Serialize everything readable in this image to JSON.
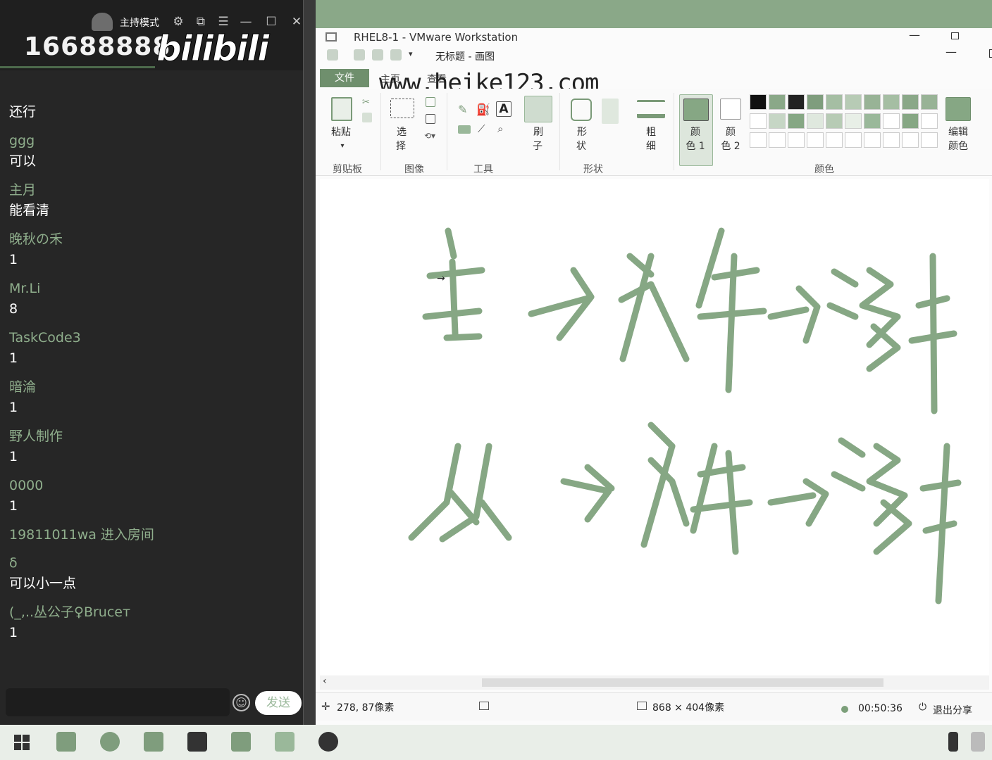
{
  "chat": {
    "host_mode": "主持模式",
    "room_id": "16688888",
    "logo": "bilibili",
    "messages": [
      {
        "name": "",
        "text": "还行"
      },
      {
        "name": "ggg",
        "text": "可以"
      },
      {
        "name": "主月",
        "text": "能看清"
      },
      {
        "name": "晚秋の禾",
        "text": "1"
      },
      {
        "name": "Mr.Li",
        "text": "8"
      },
      {
        "name": "TaskCode3",
        "text": "1"
      },
      {
        "name": "暗淪",
        "text": "1"
      },
      {
        "name": "野人制作",
        "text": "1"
      },
      {
        "name": "0000",
        "text": "1"
      },
      {
        "name": "19811011wa 进入房间",
        "text": ""
      },
      {
        "name": "δ",
        "text": "可以小一点"
      },
      {
        "name": "(_,..丛公子♀Bruceт",
        "text": "1"
      }
    ],
    "send_label": "发送"
  },
  "vmware": {
    "title": "RHEL8-1 - VMware Workstation"
  },
  "paint": {
    "title": "无标题 - 画图",
    "tabs": {
      "file": "文件",
      "home": "主页",
      "view": "查看"
    },
    "watermark": "www.heike123.com",
    "tools": {
      "paste": "粘贴",
      "select_a": "选",
      "select_b": "择",
      "brush_a": "刷",
      "brush_b": "子",
      "shape_a": "形",
      "shape_b": "状",
      "size_a": "粗",
      "size_b": "细",
      "color1_a": "颜",
      "color1_b": "色 1",
      "color2_a": "颜",
      "color2_b": "色 2",
      "edit_a": "编辑",
      "edit_b": "颜色"
    },
    "groups": {
      "clipboard": "剪贴板",
      "image": "图像",
      "tools": "工具",
      "shapes": "形状",
      "colors": "颜色"
    },
    "status": {
      "cursor_pos": "278, 87像素",
      "canvas_size": "868 × 404像素",
      "timer": "00:50:36",
      "exit_share": "退出分享"
    }
  },
  "colors": {
    "accent": "#8fae8c",
    "chat_bg": "#262626",
    "ink": "#86a784",
    "file_tab": "#6f8f6d"
  }
}
